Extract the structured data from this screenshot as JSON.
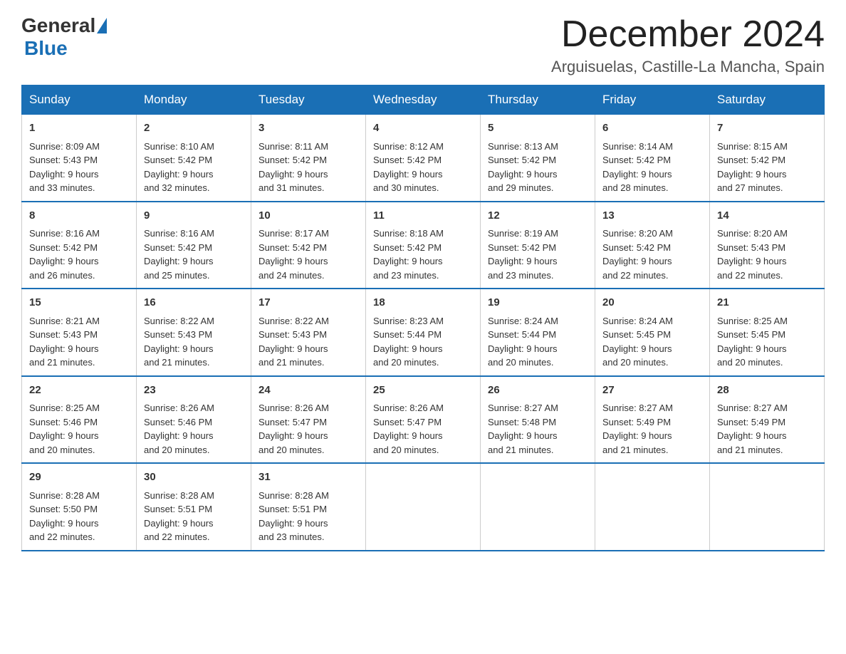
{
  "header": {
    "logo_general": "General",
    "logo_blue": "Blue",
    "month_title": "December 2024",
    "location": "Arguisuelas, Castille-La Mancha, Spain"
  },
  "weekdays": [
    "Sunday",
    "Monday",
    "Tuesday",
    "Wednesday",
    "Thursday",
    "Friday",
    "Saturday"
  ],
  "weeks": [
    [
      {
        "day": "1",
        "sunrise": "8:09 AM",
        "sunset": "5:43 PM",
        "daylight": "9 hours and 33 minutes."
      },
      {
        "day": "2",
        "sunrise": "8:10 AM",
        "sunset": "5:42 PM",
        "daylight": "9 hours and 32 minutes."
      },
      {
        "day": "3",
        "sunrise": "8:11 AM",
        "sunset": "5:42 PM",
        "daylight": "9 hours and 31 minutes."
      },
      {
        "day": "4",
        "sunrise": "8:12 AM",
        "sunset": "5:42 PM",
        "daylight": "9 hours and 30 minutes."
      },
      {
        "day": "5",
        "sunrise": "8:13 AM",
        "sunset": "5:42 PM",
        "daylight": "9 hours and 29 minutes."
      },
      {
        "day": "6",
        "sunrise": "8:14 AM",
        "sunset": "5:42 PM",
        "daylight": "9 hours and 28 minutes."
      },
      {
        "day": "7",
        "sunrise": "8:15 AM",
        "sunset": "5:42 PM",
        "daylight": "9 hours and 27 minutes."
      }
    ],
    [
      {
        "day": "8",
        "sunrise": "8:16 AM",
        "sunset": "5:42 PM",
        "daylight": "9 hours and 26 minutes."
      },
      {
        "day": "9",
        "sunrise": "8:16 AM",
        "sunset": "5:42 PM",
        "daylight": "9 hours and 25 minutes."
      },
      {
        "day": "10",
        "sunrise": "8:17 AM",
        "sunset": "5:42 PM",
        "daylight": "9 hours and 24 minutes."
      },
      {
        "day": "11",
        "sunrise": "8:18 AM",
        "sunset": "5:42 PM",
        "daylight": "9 hours and 23 minutes."
      },
      {
        "day": "12",
        "sunrise": "8:19 AM",
        "sunset": "5:42 PM",
        "daylight": "9 hours and 23 minutes."
      },
      {
        "day": "13",
        "sunrise": "8:20 AM",
        "sunset": "5:42 PM",
        "daylight": "9 hours and 22 minutes."
      },
      {
        "day": "14",
        "sunrise": "8:20 AM",
        "sunset": "5:43 PM",
        "daylight": "9 hours and 22 minutes."
      }
    ],
    [
      {
        "day": "15",
        "sunrise": "8:21 AM",
        "sunset": "5:43 PM",
        "daylight": "9 hours and 21 minutes."
      },
      {
        "day": "16",
        "sunrise": "8:22 AM",
        "sunset": "5:43 PM",
        "daylight": "9 hours and 21 minutes."
      },
      {
        "day": "17",
        "sunrise": "8:22 AM",
        "sunset": "5:43 PM",
        "daylight": "9 hours and 21 minutes."
      },
      {
        "day": "18",
        "sunrise": "8:23 AM",
        "sunset": "5:44 PM",
        "daylight": "9 hours and 20 minutes."
      },
      {
        "day": "19",
        "sunrise": "8:24 AM",
        "sunset": "5:44 PM",
        "daylight": "9 hours and 20 minutes."
      },
      {
        "day": "20",
        "sunrise": "8:24 AM",
        "sunset": "5:45 PM",
        "daylight": "9 hours and 20 minutes."
      },
      {
        "day": "21",
        "sunrise": "8:25 AM",
        "sunset": "5:45 PM",
        "daylight": "9 hours and 20 minutes."
      }
    ],
    [
      {
        "day": "22",
        "sunrise": "8:25 AM",
        "sunset": "5:46 PM",
        "daylight": "9 hours and 20 minutes."
      },
      {
        "day": "23",
        "sunrise": "8:26 AM",
        "sunset": "5:46 PM",
        "daylight": "9 hours and 20 minutes."
      },
      {
        "day": "24",
        "sunrise": "8:26 AM",
        "sunset": "5:47 PM",
        "daylight": "9 hours and 20 minutes."
      },
      {
        "day": "25",
        "sunrise": "8:26 AM",
        "sunset": "5:47 PM",
        "daylight": "9 hours and 20 minutes."
      },
      {
        "day": "26",
        "sunrise": "8:27 AM",
        "sunset": "5:48 PM",
        "daylight": "9 hours and 21 minutes."
      },
      {
        "day": "27",
        "sunrise": "8:27 AM",
        "sunset": "5:49 PM",
        "daylight": "9 hours and 21 minutes."
      },
      {
        "day": "28",
        "sunrise": "8:27 AM",
        "sunset": "5:49 PM",
        "daylight": "9 hours and 21 minutes."
      }
    ],
    [
      {
        "day": "29",
        "sunrise": "8:28 AM",
        "sunset": "5:50 PM",
        "daylight": "9 hours and 22 minutes."
      },
      {
        "day": "30",
        "sunrise": "8:28 AM",
        "sunset": "5:51 PM",
        "daylight": "9 hours and 22 minutes."
      },
      {
        "day": "31",
        "sunrise": "8:28 AM",
        "sunset": "5:51 PM",
        "daylight": "9 hours and 23 minutes."
      },
      null,
      null,
      null,
      null
    ]
  ],
  "labels": {
    "sunrise": "Sunrise:",
    "sunset": "Sunset:",
    "daylight": "Daylight:"
  }
}
